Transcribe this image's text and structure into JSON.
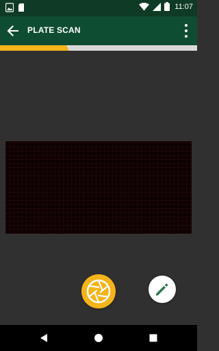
{
  "status_bar": {
    "time": "11:07",
    "icons": [
      "photo-icon",
      "sd-card-icon",
      "wifi-icon",
      "signal-icon",
      "battery-icon"
    ]
  },
  "app_bar": {
    "title": "PLATE SCAN",
    "back_icon": "arrow-back-icon",
    "menu_icon": "more-vert-icon"
  },
  "progress": {
    "value": 0.35
  },
  "controls": {
    "shutter_icon": "camera-shutter-icon",
    "edit_icon": "pencil-icon"
  },
  "nav_bar": {
    "icons": [
      "back-triangle-icon",
      "home-circle-icon",
      "recents-square-icon"
    ]
  },
  "colors": {
    "status_bar": "#0f3b26",
    "app_bar": "#0f4d32",
    "accent": "#f4b41a",
    "background": "#313031",
    "plate_frame": "#0d0203"
  }
}
